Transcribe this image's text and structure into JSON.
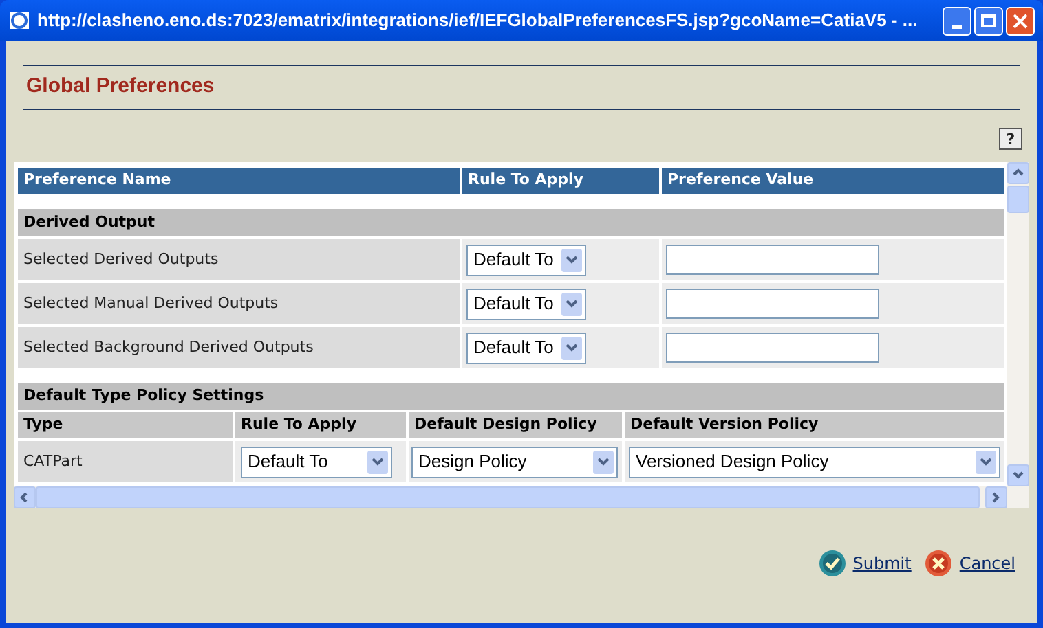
{
  "window": {
    "title": "http://clasheno.eno.ds:7023/ematrix/integrations/ief/IEFGlobalPreferencesFS.jsp?gcoName=CatiaV5 - ..."
  },
  "page_title": "Global Preferences",
  "help_button": "?",
  "table": {
    "columns": [
      "Preference Name",
      "Rule To Apply",
      "Preference Value"
    ],
    "sections": [
      {
        "title": "Derived Output",
        "rows": [
          {
            "name": "Selected Derived Outputs",
            "rule": "Default To"
          },
          {
            "name": "Selected Manual Derived Outputs",
            "rule": "Default To"
          },
          {
            "name": "Selected Background Derived Outputs",
            "rule": "Default To"
          }
        ]
      }
    ]
  },
  "policy_table": {
    "title": "Default Type Policy Settings",
    "columns": [
      "Type",
      "Rule To Apply",
      "Default Design Policy",
      "Default Version Policy"
    ],
    "rows": [
      {
        "type": "CATPart",
        "rule": "Default To",
        "design_policy": "Design Policy",
        "version_policy": "Versioned Design Policy"
      }
    ]
  },
  "actions": [
    {
      "kind": "submit",
      "label": "Submit"
    },
    {
      "kind": "cancel",
      "label": "Cancel"
    }
  ]
}
